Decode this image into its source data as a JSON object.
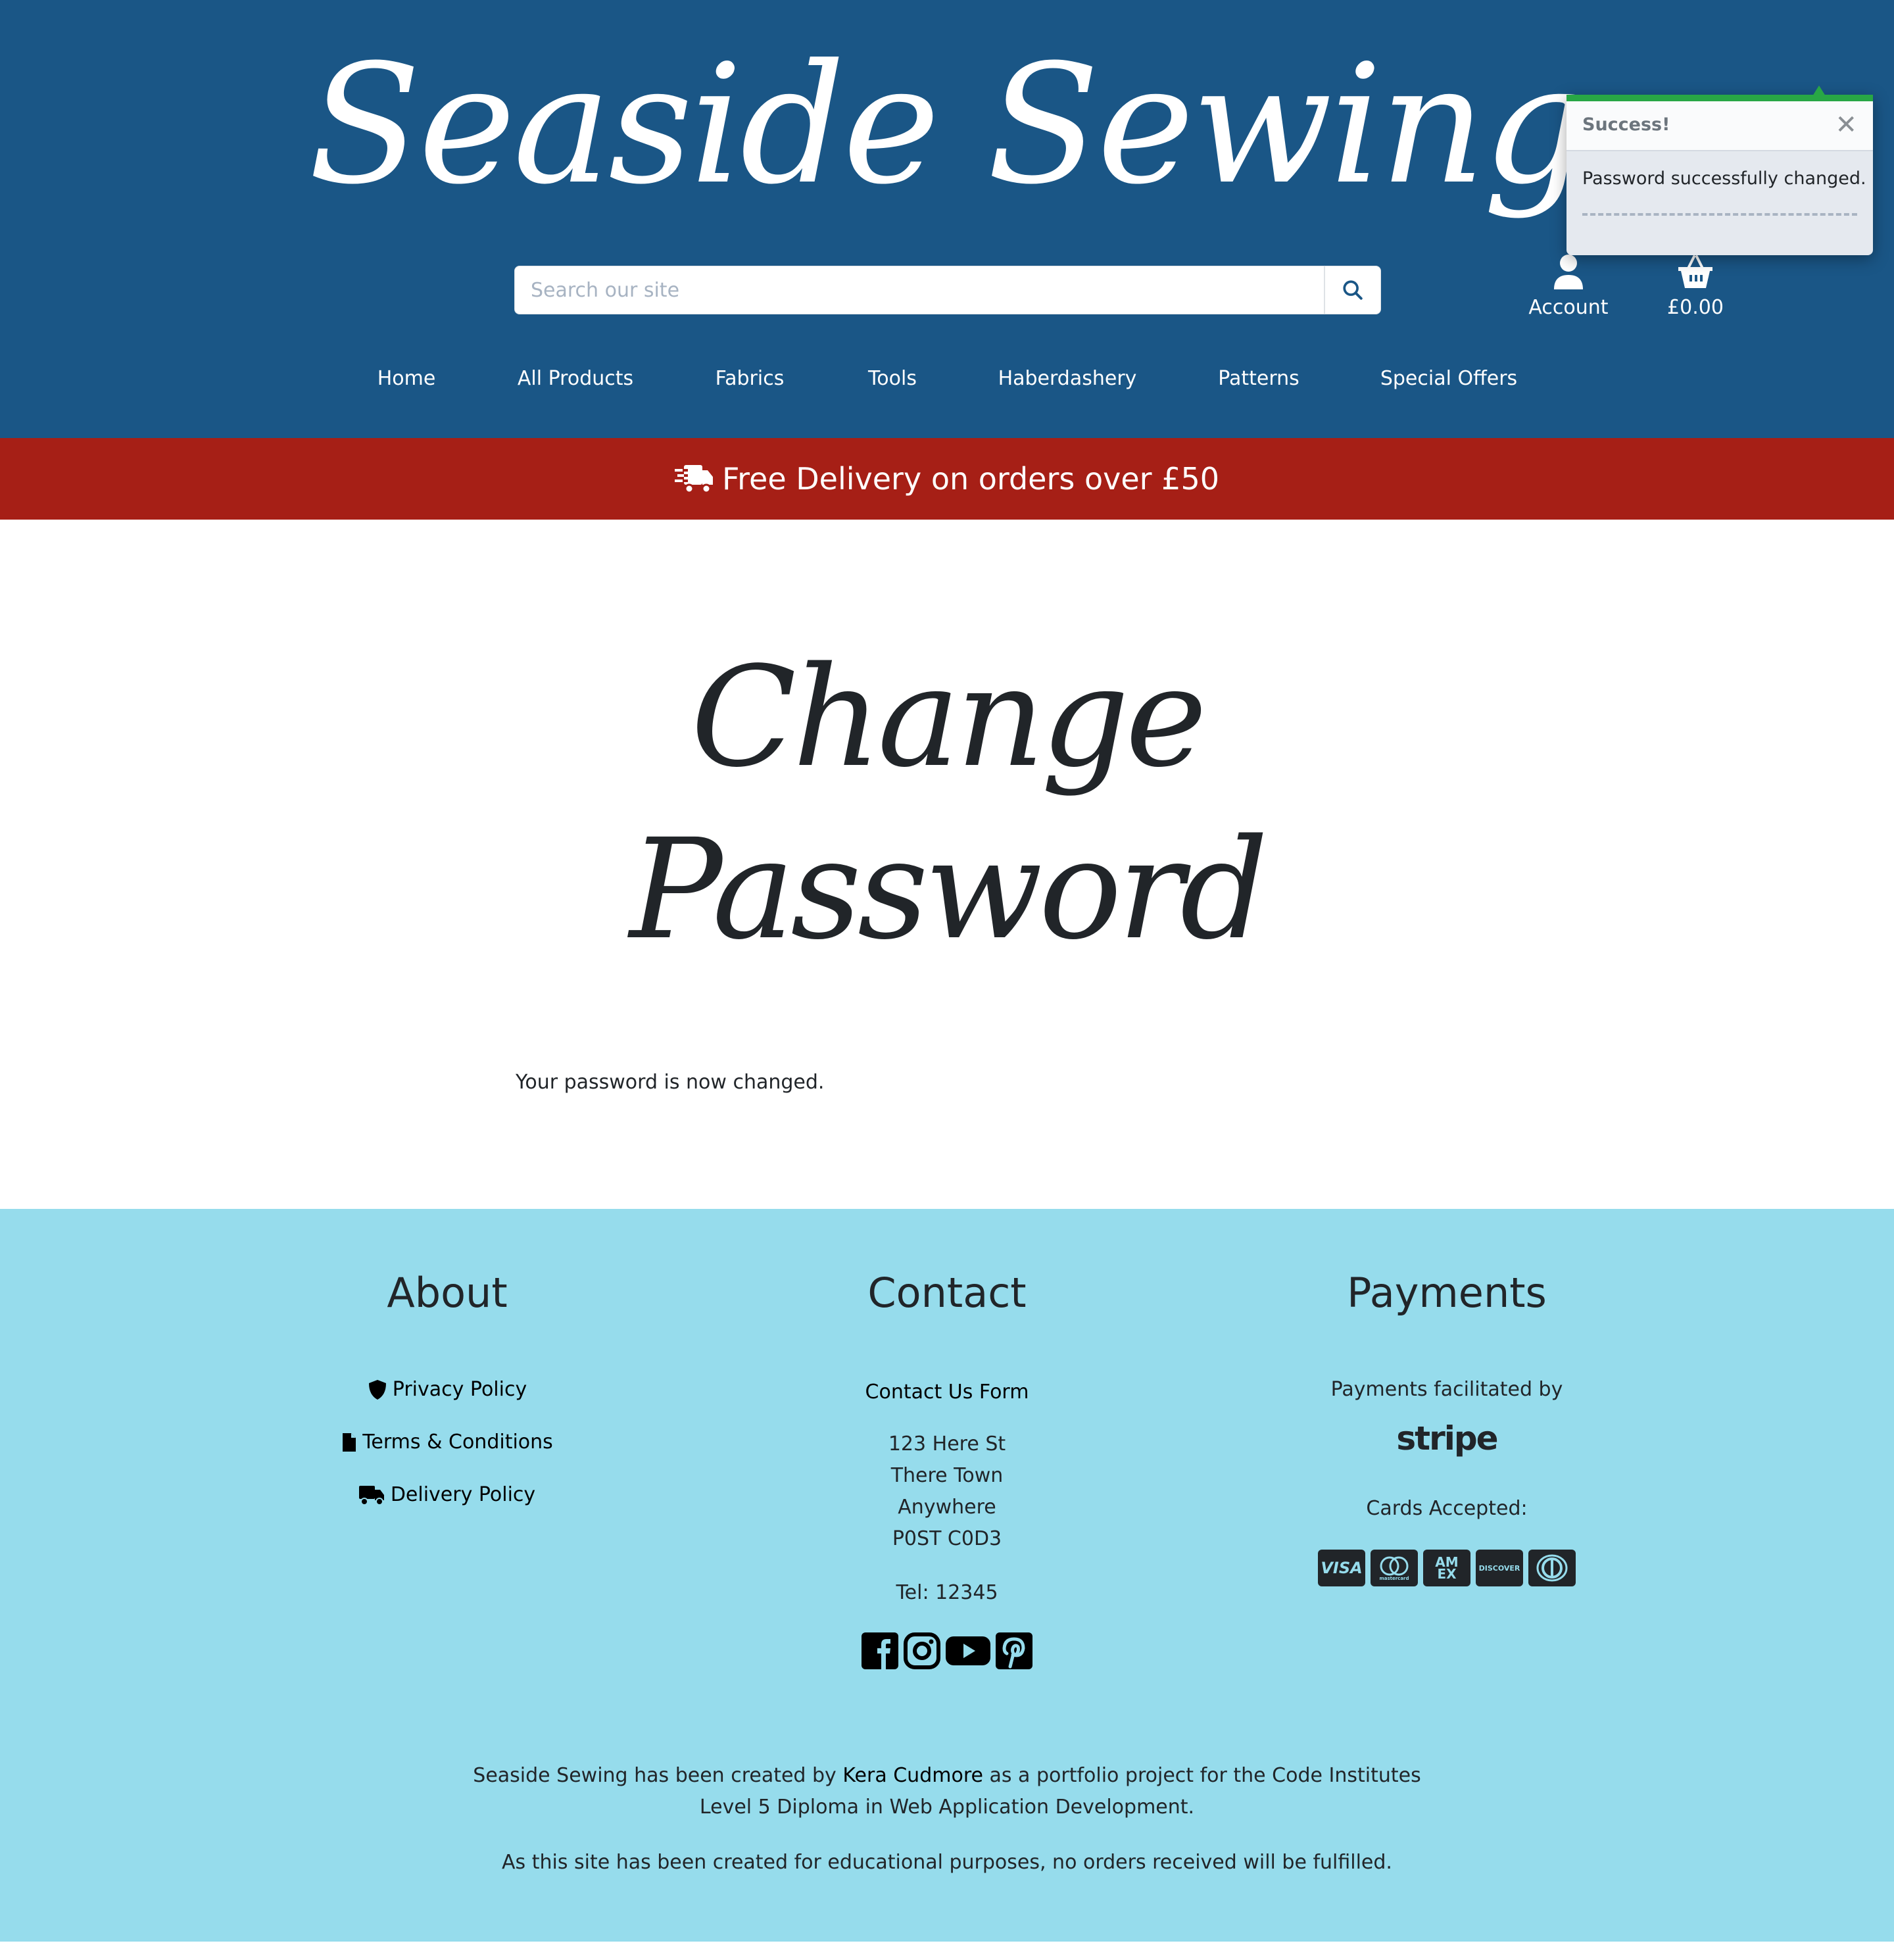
{
  "header": {
    "logo": "Seaside Sewing",
    "search": {
      "placeholder": "Search our site",
      "value": ""
    },
    "account_label": "Account",
    "basket_total": "£0.00"
  },
  "nav": {
    "items": [
      {
        "label": "Home"
      },
      {
        "label": "All Products"
      },
      {
        "label": "Fabrics"
      },
      {
        "label": "Tools"
      },
      {
        "label": "Haberdashery"
      },
      {
        "label": "Patterns"
      },
      {
        "label": "Special Offers"
      }
    ]
  },
  "banner": {
    "text": "Free Delivery on orders over £50",
    "icon": "shipping-fast-icon"
  },
  "main": {
    "title_line1": "Change",
    "title_line2": "Password",
    "message": "Your password is now changed."
  },
  "toast": {
    "title": "Success!",
    "message": "Password successfully changed.",
    "close": "✕",
    "accent_color": "#28a745"
  },
  "footer": {
    "about": {
      "heading": "About",
      "links": [
        {
          "label": "Privacy Policy",
          "icon": "shield-icon"
        },
        {
          "label": "Terms & Conditions",
          "icon": "file-icon"
        },
        {
          "label": "Delivery Policy",
          "icon": "truck-icon"
        }
      ]
    },
    "contact": {
      "heading": "Contact",
      "form_link": "Contact Us Form",
      "address": [
        "123 Here St",
        "There Town",
        "Anywhere",
        "P0ST C0D3"
      ],
      "tel": "Tel: 12345",
      "socials": [
        "facebook",
        "instagram",
        "youtube",
        "pinterest"
      ]
    },
    "payments": {
      "heading": "Payments",
      "facilitated": "Payments facilitated by",
      "provider": "stripe",
      "cards_label": "Cards Accepted:",
      "cards": [
        "VISA",
        "mastercard",
        "AMEX",
        "DISCOVER",
        "Diners Club"
      ]
    },
    "credits": {
      "before": "Seaside Sewing has been created by ",
      "name": "Kera Cudmore",
      "after": " as a portfolio project for the Code Institutes Level 5 Diploma in Web Application Development."
    },
    "disclaimer": "As this site has been created for educational purposes, no orders received will be fulfilled."
  },
  "colors": {
    "header_bg": "#1a5686",
    "banner_bg": "#a61f16",
    "footer_bg": "#96dcec",
    "toast_success": "#28a745"
  }
}
